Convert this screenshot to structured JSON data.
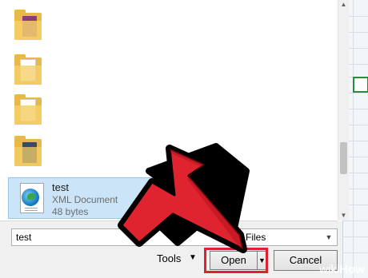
{
  "file_list": {
    "selected_file": {
      "name": "test",
      "type": "XML Document",
      "size": "48 bytes",
      "icon": "xml-document-icon"
    },
    "folders": [
      {
        "icon": "folder-icon"
      },
      {
        "icon": "folder-icon"
      },
      {
        "icon": "folder-icon"
      },
      {
        "icon": "folder-icon"
      }
    ]
  },
  "filename_field": {
    "value": "test"
  },
  "file_type_filter": {
    "selected": "Files"
  },
  "tools_menu": {
    "label": "Tools"
  },
  "buttons": {
    "open": "Open",
    "cancel": "Cancel"
  },
  "colors": {
    "highlight_red": "#e0202c",
    "selection_blue": "#cce4f7",
    "folder_yellow": "#e8b948"
  },
  "watermark": {
    "part1": "wiki",
    "part2": "How"
  }
}
